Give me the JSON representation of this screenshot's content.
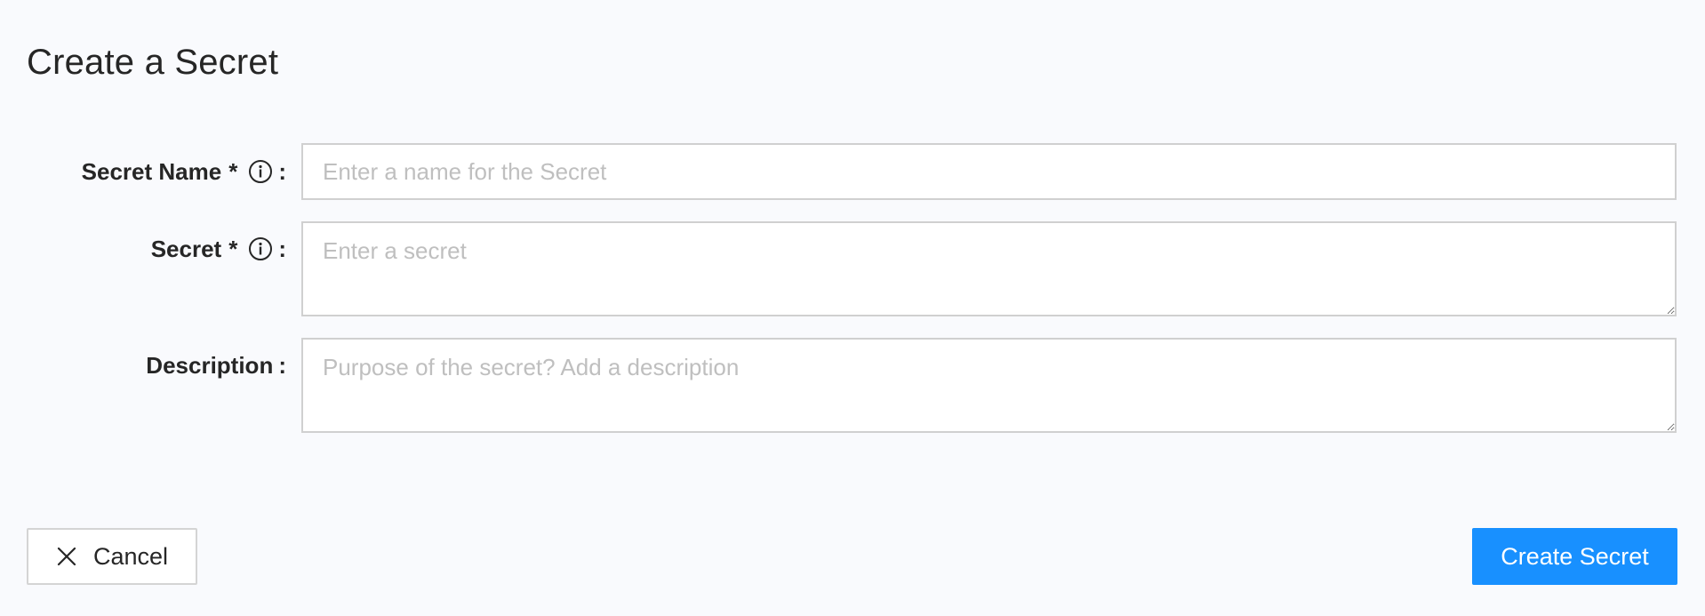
{
  "page": {
    "title": "Create a Secret"
  },
  "form": {
    "secret_name": {
      "label": "Secret Name",
      "required_mark": "*",
      "colon": ":",
      "placeholder": "Enter a name for the Secret",
      "value": ""
    },
    "secret": {
      "label": "Secret",
      "required_mark": "*",
      "colon": ":",
      "placeholder": "Enter a secret",
      "value": ""
    },
    "description": {
      "label": "Description",
      "colon": ":",
      "placeholder": "Purpose of the secret? Add a description",
      "value": ""
    }
  },
  "actions": {
    "cancel_label": "Cancel",
    "create_label": "Create Secret"
  },
  "icons": {
    "info": "info-circle-icon",
    "close": "close-icon"
  },
  "colors": {
    "primary": "#1890ff",
    "background": "#f9fafd",
    "border": "#d0d0d0",
    "placeholder": "#bfbfbf",
    "text": "#262626"
  }
}
